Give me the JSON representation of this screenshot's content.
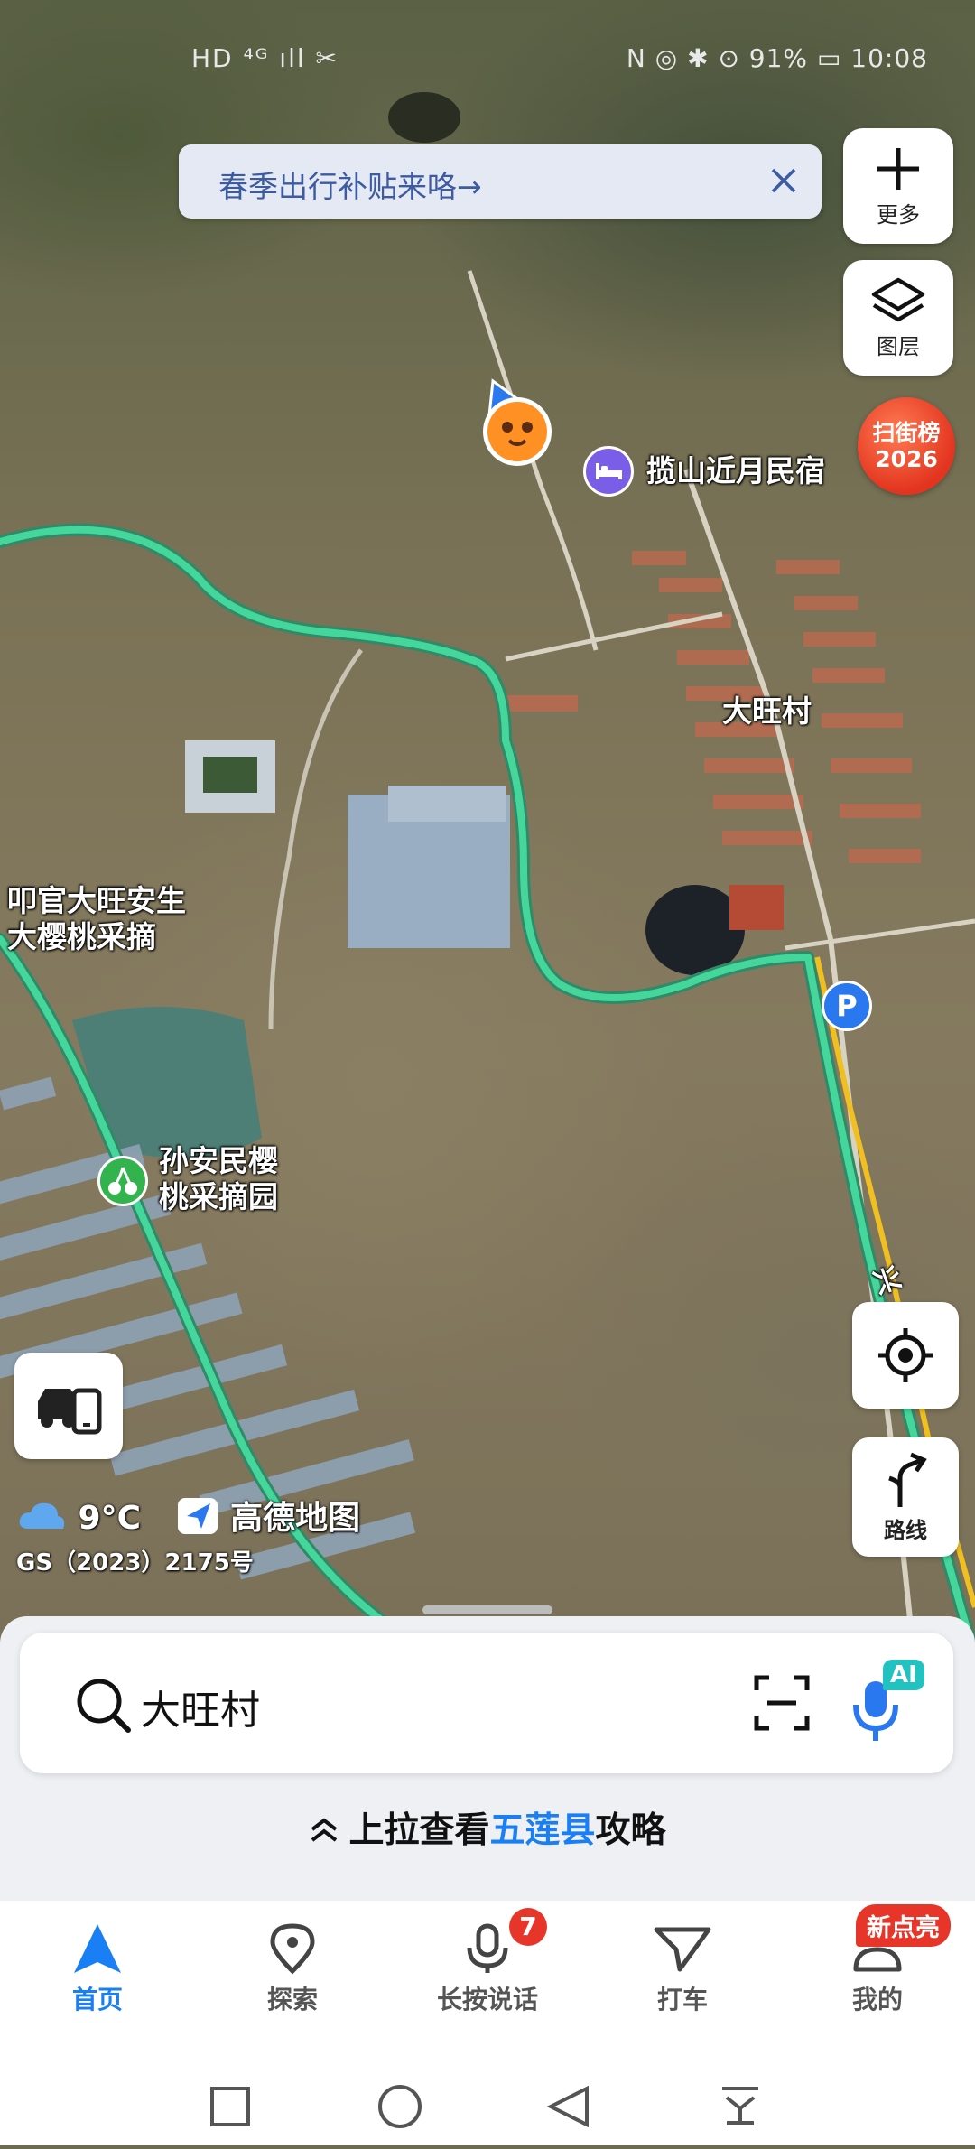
{
  "status_bar": {
    "left": "HD ⁴ᴳ ıll ✂",
    "right": "N ◎ ✱ ⊙ 91% ▭ 10:08"
  },
  "banner": {
    "text": "春季出行补贴来咯→"
  },
  "side_buttons": {
    "more_label": "更多",
    "layers_label": "图层",
    "route_label": "路线"
  },
  "rank_badge": {
    "line1": "扫街榜",
    "line2": "2026"
  },
  "map_labels": {
    "homestay": "揽山近月民宿",
    "village": "大旺村",
    "cherry_farm_line1": "叩官大旺安生",
    "cherry_farm_line2": "大樱桃采摘",
    "orchard_line1": "孙安民樱",
    "orchard_line2": "桃采摘园",
    "road_label": "兴"
  },
  "weather": {
    "temp": "9°C",
    "brand": "高德地图"
  },
  "license": "GS（2023）2175号",
  "search": {
    "value": "大旺村"
  },
  "guide": {
    "prefix": "上拉查看",
    "highlight": "五莲县",
    "suffix": "攻略"
  },
  "tabs": [
    {
      "label": "首页"
    },
    {
      "label": "探索"
    },
    {
      "label": "长按说话",
      "badge": "7"
    },
    {
      "label": "打车"
    },
    {
      "label": "我的",
      "badge": "新点亮"
    }
  ],
  "ai_badge": "AI",
  "colors": {
    "accent": "#1a7ef5",
    "route": "#3ec98f",
    "badge": "#e8352a"
  }
}
